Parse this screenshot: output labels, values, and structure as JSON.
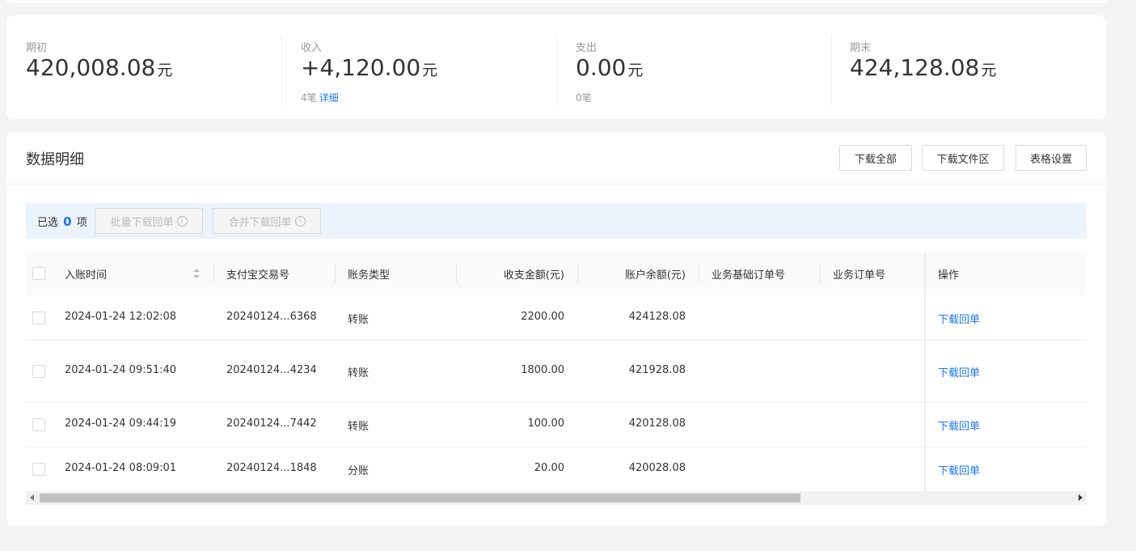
{
  "summary": [
    {
      "label": "期初",
      "amount": "420,008.08",
      "unit": "元",
      "count": "",
      "link": ""
    },
    {
      "label": "收入",
      "amount": "+4,120.00",
      "unit": "元",
      "count": "4笔",
      "link": "详细"
    },
    {
      "label": "支出",
      "amount": "0.00",
      "unit": "元",
      "count": "0笔",
      "link": ""
    },
    {
      "label": "期末",
      "amount": "424,128.08",
      "unit": "元",
      "count": "",
      "link": ""
    }
  ],
  "detail": {
    "title": "数据明细",
    "buttons": {
      "download_all": "下载全部",
      "download_files": "下载文件区",
      "table_settings": "表格设置"
    },
    "selection": {
      "prefix": "已选",
      "count": "0",
      "suffix": "项",
      "batch_download": "批量下载回单",
      "merge_download": "合并下载回单",
      "info_glyph": "i"
    }
  },
  "table": {
    "columns": [
      "入账时间",
      "支付宝交易号",
      "账务类型",
      "收支金额(元)",
      "账户余额(元)",
      "业务基础订单号",
      "业务订单号",
      "操作"
    ],
    "rows": [
      {
        "time": "2024-01-24 12:02:08",
        "trade_no": "20240124...6368",
        "type": "转账",
        "amount": "2200.00",
        "balance": "424128.08",
        "base_order": "",
        "order": "",
        "action": "下载回单"
      },
      {
        "time": "2024-01-24 09:51:40",
        "trade_no": "20240124...4234",
        "type": "转账",
        "amount": "1800.00",
        "balance": "421928.08",
        "base_order": "",
        "order": "",
        "action": "下载回单"
      },
      {
        "time": "2024-01-24 09:44:19",
        "trade_no": "20240124...7442",
        "type": "转账",
        "amount": "100.00",
        "balance": "420128.08",
        "base_order": "",
        "order": "",
        "action": "下载回单"
      },
      {
        "time": "2024-01-24 08:09:01",
        "trade_no": "20240124...1848",
        "type": "分账",
        "amount": "20.00",
        "balance": "420028.08",
        "base_order": "",
        "order": "",
        "action": "下载回单"
      }
    ]
  },
  "colors": {
    "accent": "#1677ff",
    "select_bar": "#ebf3fd"
  },
  "icons": {
    "sort": "sort-icon",
    "info": "info-icon"
  }
}
